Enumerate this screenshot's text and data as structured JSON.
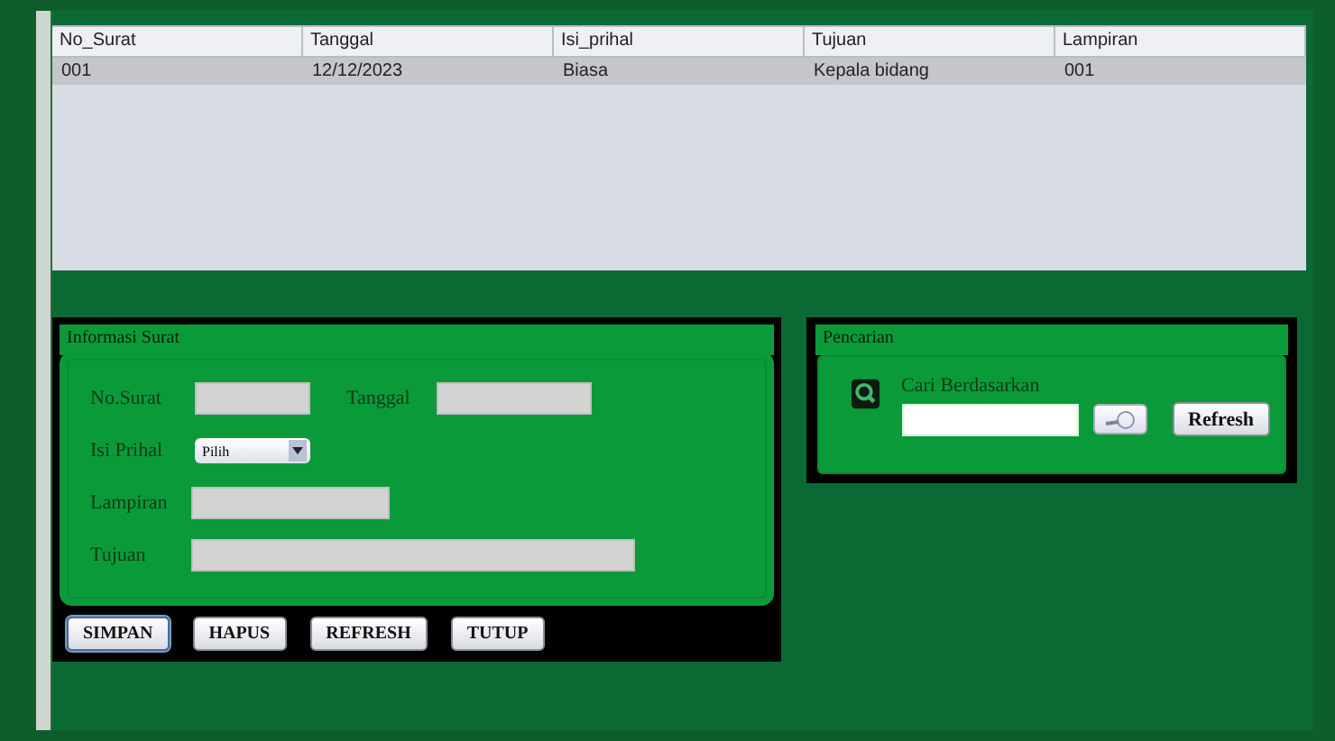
{
  "table": {
    "columns": [
      "No_Surat",
      "Tanggal",
      "Isi_prihal",
      "Tujuan",
      "Lampiran"
    ],
    "rows": [
      {
        "cells": [
          "001",
          "12/12/2023",
          "Biasa",
          "Kepala bidang",
          "001"
        ],
        "selected": true
      }
    ]
  },
  "info_panel": {
    "title": "Informasi Surat",
    "no_surat_label": "No.Surat",
    "tanggal_label": "Tanggal",
    "isi_prihal_label": "Isi Prihal",
    "isi_prihal_value": "Pilih",
    "lampiran_label": "Lampiran",
    "tujuan_label": "Tujuan"
  },
  "buttons": [
    {
      "label": "SIMPAN",
      "selected": true
    },
    {
      "label": "HAPUS",
      "selected": false
    },
    {
      "label": "REFRESH",
      "selected": false
    },
    {
      "label": "TUTUP",
      "selected": false
    }
  ],
  "search_panel": {
    "title": "Pencarian",
    "label": "Cari Berdasarkan",
    "refresh_button": "Refresh"
  }
}
